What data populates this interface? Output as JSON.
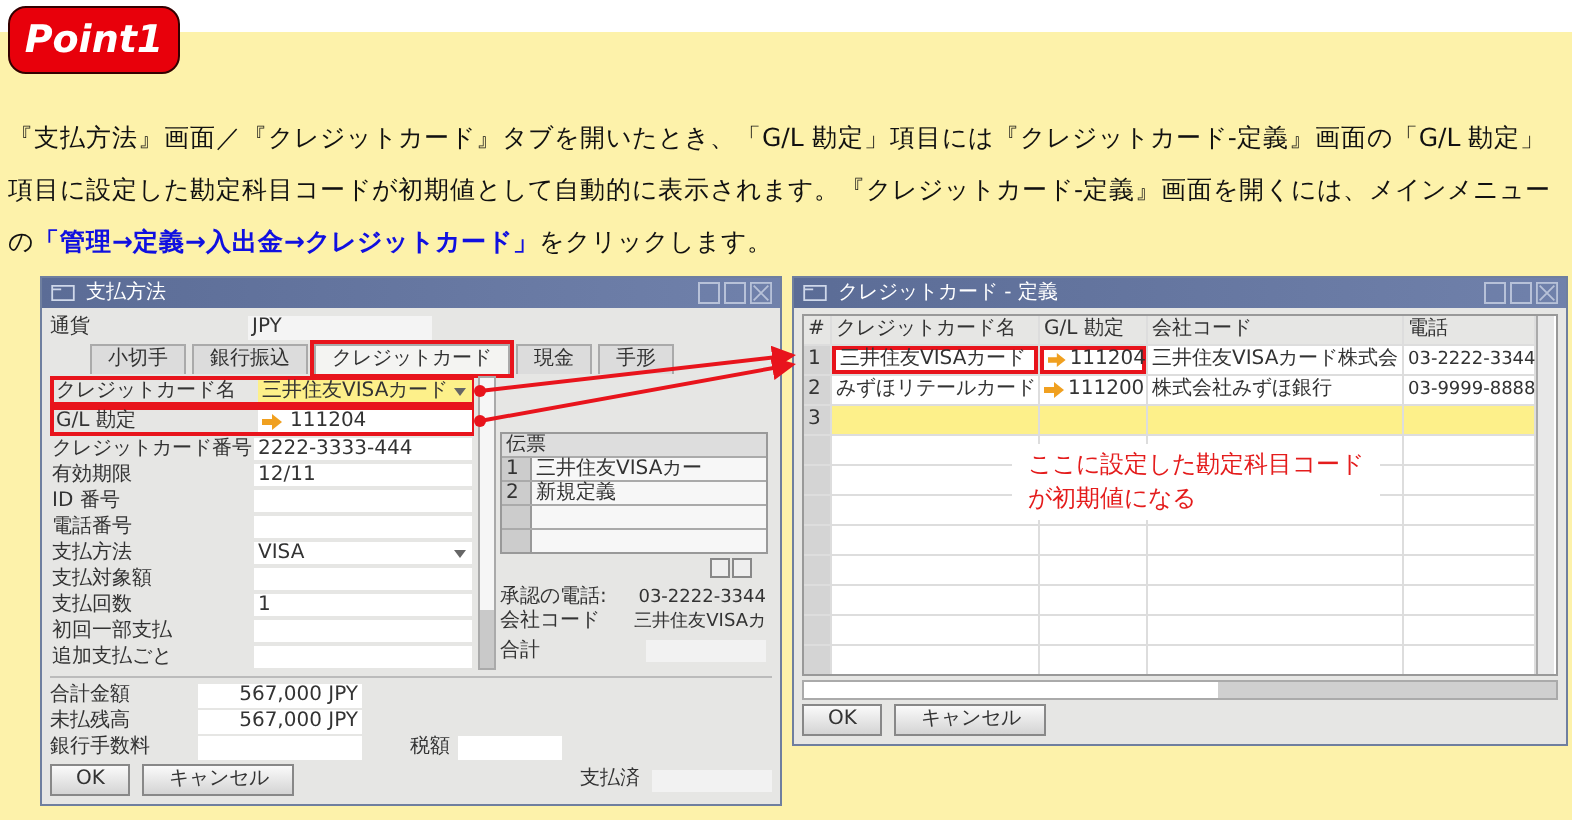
{
  "badge": "Point1",
  "intro": {
    "before": "『支払方法』画面／『クレジットカード』タブを開いたとき、「G/L 勘定」項目には『クレジットカード-定義』画面の「G/L 勘定」項目に設定した勘定科目コードが初期値として自動的に表示されます。『クレジットカード-定義』画面を開くには、メインメニューの",
    "link": "「管理→定義→入出金→クレジットカード」",
    "after": "をクリックします。"
  },
  "payment_window": {
    "title": "支払方法",
    "currency_label": "通貨",
    "currency": "JPY",
    "tabs": [
      {
        "label": "小切手",
        "selected": false,
        "highlighted": false
      },
      {
        "label": "銀行振込",
        "selected": false,
        "highlighted": false
      },
      {
        "label": "クレジットカード",
        "selected": true,
        "highlighted": true
      },
      {
        "label": "現金",
        "selected": false,
        "highlighted": false
      },
      {
        "label": "手形",
        "selected": false,
        "highlighted": false
      }
    ],
    "fields": [
      {
        "label": "クレジットカード名",
        "value": "三井住友VISAカード",
        "kind": "dropdown",
        "active": true,
        "highlighted": true
      },
      {
        "label": "G/L 勘定",
        "value": "111204",
        "kind": "link",
        "active": false,
        "highlighted": true
      },
      {
        "label": "クレジットカード番号",
        "value": "2222-3333-444",
        "kind": "text",
        "active": false,
        "highlighted": false
      },
      {
        "label": "有効期限",
        "value": "12/11",
        "kind": "text",
        "active": false,
        "highlighted": false
      },
      {
        "label": "ID 番号",
        "kind": "text",
        "active": false,
        "highlighted": false
      },
      {
        "label": "電話番号",
        "kind": "text",
        "active": false,
        "highlighted": false
      },
      {
        "label": "支払方法",
        "value": "VISA",
        "kind": "dropdown",
        "active": false,
        "highlighted": false
      },
      {
        "label": "支払対象額",
        "kind": "text",
        "active": false,
        "highlighted": false
      },
      {
        "label": "支払回数",
        "value": "1",
        "kind": "text",
        "active": false,
        "highlighted": false
      },
      {
        "label": "初回一部支払",
        "kind": "text",
        "active": false,
        "highlighted": false
      },
      {
        "label": "追加支払ごと",
        "kind": "text",
        "active": false,
        "highlighted": false
      }
    ],
    "installments": {
      "header": "伝票",
      "rows": [
        {
          "number": "1",
          "name": "三井住友VISAカー"
        },
        {
          "number": "2",
          "name": "新規定義"
        }
      ]
    },
    "info": [
      {
        "label": "承認の電話:",
        "value": "03-2222-3344"
      },
      {
        "label": "会社コード",
        "value": "三井住友VISAカ"
      }
    ],
    "subtotal_label": "合計",
    "totals": [
      {
        "label": "合計金額",
        "value": "567,000 JPY"
      },
      {
        "label": "未払残高",
        "value": "567,000 JPY"
      }
    ],
    "fee_label": "銀行手数料",
    "tax_label": "税額",
    "paid_label": "支払済",
    "buttons": [
      "OK",
      "キャンセル"
    ]
  },
  "definition_window": {
    "title": "クレジットカード - 定義",
    "columns": [
      "#",
      "クレジットカード名",
      "G/L 勘定",
      "会社コード",
      "電話"
    ],
    "rows": [
      {
        "number": "1",
        "name": "三井住友VISAカード",
        "gl_account": "111204",
        "company": "三井住友VISAカード株式会",
        "phone": "03-2222-3344",
        "highlighted": true,
        "editing": false
      },
      {
        "number": "2",
        "name": "みずほリテールカード",
        "gl_account": "111200",
        "company": "株式会社みずほ銀行",
        "phone": "03-9999-8888",
        "highlighted": false,
        "editing": false
      },
      {
        "number": "3",
        "highlighted": false,
        "editing": true
      }
    ],
    "callout": [
      "ここに設定した勘定科目コード",
      "が初期値になる"
    ],
    "buttons": [
      "OK",
      "キャンセル"
    ]
  }
}
